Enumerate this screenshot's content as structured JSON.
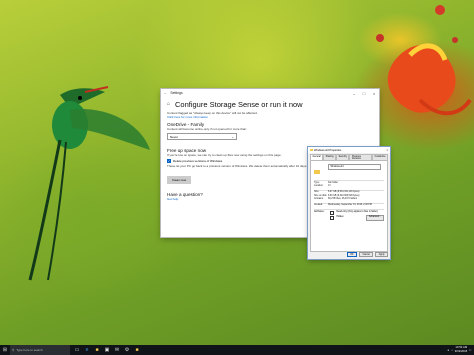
{
  "settings_window": {
    "title": "Settings",
    "heading": "Configure Storage Sense or run it now",
    "intro": "Content flagged as \"Always keep on this device\" will not be affected.",
    "info_link": "Click here for more information",
    "onedrive_heading": "OneDrive - Family",
    "onedrive_desc": "Content will become online-only if not opened for more than:",
    "onedrive_value": "Never",
    "free_up_heading": "Free up space now",
    "free_up_desc": "If you're low on space, we can try to clean up files now using the settings on this page.",
    "delete_previous_label": "Delete previous versions of Windows",
    "delete_previous_desc": "These let your PC go back to a previous version of Windows. We delete them automatically after 10 days.",
    "clean_now_label": "Clean now",
    "question_heading": "Have a question?",
    "get_help_link": "Get help"
  },
  "properties_dialog": {
    "title": "Windows.old Properties",
    "tabs": [
      "General",
      "Sharing",
      "Security",
      "Previous Versions",
      "Customize"
    ],
    "folder_name": "Windows.old",
    "rows": [
      {
        "key": "Type:",
        "value": "File folder"
      },
      {
        "key": "Location:",
        "value": "C:\\"
      },
      {
        "key": "Size:",
        "value": "8.97 GB (9,634,331,146 bytes)"
      },
      {
        "key": "Size on disk:",
        "value": "8.60 GB (9,243,926,528 bytes)"
      },
      {
        "key": "Contains:",
        "value": "60,278 Files, 26,247 Folders"
      }
    ],
    "created_key": "Created:",
    "created_value": "Wednesday, September 19, 2018, 2:28 PM",
    "attributes_key": "Attributes:",
    "readonly_label": "Read-only (Only applies to files in folder)",
    "hidden_label": "Hidden",
    "advanced_label": "Advanced...",
    "ok_label": "OK",
    "cancel_label": "Cancel",
    "apply_label": "Apply"
  },
  "taskbar": {
    "search_placeholder": "Type here to search",
    "time": "10:53 AM",
    "date": "9/19/2018"
  },
  "colors": {
    "accent": "#0a63c7",
    "taskbar": "#101418"
  },
  "icons": [
    "home-icon",
    "windows-start-icon",
    "search-icon",
    "task-view-icon",
    "edge-icon",
    "file-explorer-icon",
    "store-icon",
    "mail-icon",
    "settings-gear-icon",
    "folder-icon",
    "notification-icon"
  ]
}
